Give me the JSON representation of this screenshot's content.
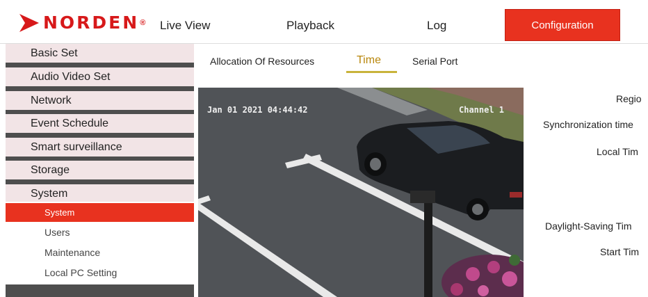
{
  "brand": {
    "name": "NORDEN",
    "reg": "®",
    "color": "#d7191a"
  },
  "nav": {
    "live_view": "Live View",
    "playback": "Playback",
    "log": "Log",
    "configuration": "Configuration",
    "active_color": "#e8321f"
  },
  "sidebar": {
    "items": [
      {
        "label": "Basic Set"
      },
      {
        "label": "Audio Video Set"
      },
      {
        "label": "Network"
      },
      {
        "label": "Event Schedule"
      },
      {
        "label": "Smart surveillance"
      },
      {
        "label": "Storage"
      },
      {
        "label": "System"
      }
    ],
    "sub_items": [
      {
        "label": "System",
        "active": true
      },
      {
        "label": "Users"
      },
      {
        "label": "Maintenance"
      },
      {
        "label": "Local PC Setting"
      }
    ]
  },
  "tabs": [
    {
      "label": "Allocation Of Resources"
    },
    {
      "label": "Time",
      "active": true
    },
    {
      "label": "Serial Port"
    }
  ],
  "video": {
    "timestamp": "Jan 01 2021 04:44:42",
    "channel": "Channel 1"
  },
  "form": {
    "labels": [
      "Regio",
      "Synchronization time",
      "Local Tim",
      "Daylight-Saving Tim",
      "Start Tim"
    ]
  }
}
